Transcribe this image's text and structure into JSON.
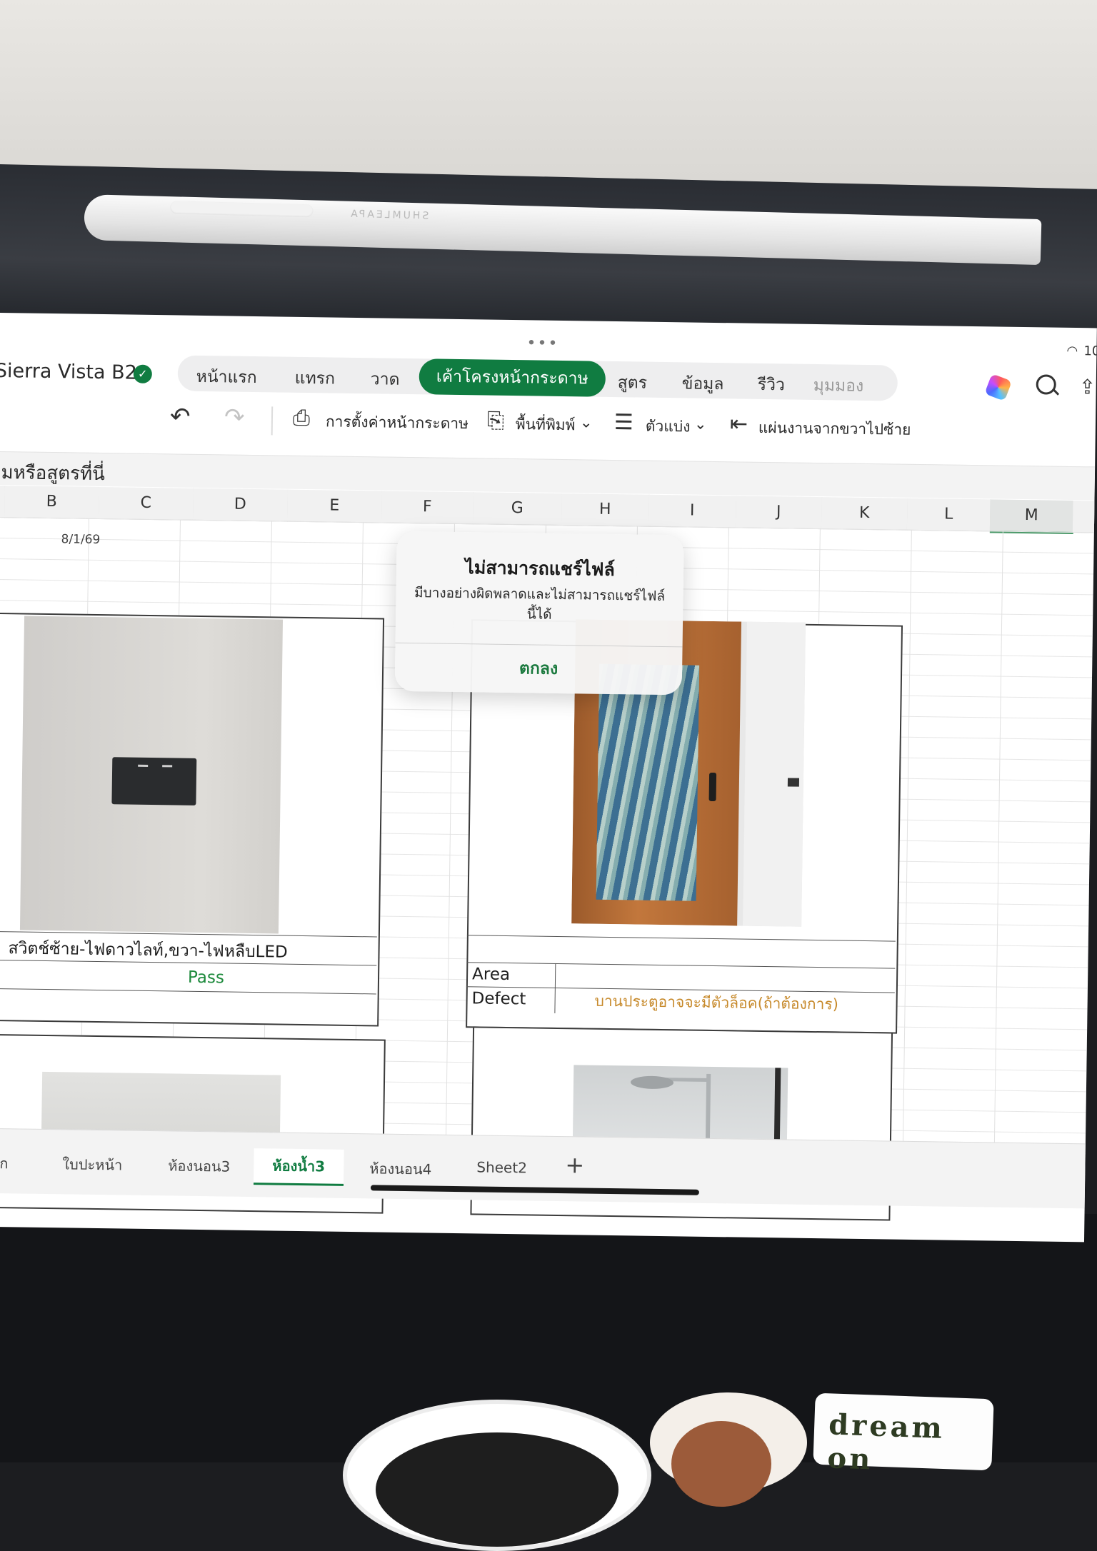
{
  "app": {
    "doc_title": "Sierra Vista B2",
    "ribbon_tabs": [
      {
        "label": "หน้าแรก"
      },
      {
        "label": "แทรก"
      },
      {
        "label": "วาด"
      },
      {
        "label": "เค้าโครงหน้ากระดาษ"
      },
      {
        "label": "สูตร"
      },
      {
        "label": "ข้อมูล"
      },
      {
        "label": "รีวิว"
      },
      {
        "label": "มุมมอง"
      }
    ],
    "active_tab": "เค้าโครงหน้ากระดาษ",
    "accent_color": "#107c41",
    "status": {
      "battery_text": "10"
    }
  },
  "toolbar": {
    "undo_icon": "undo-icon",
    "redo_icon": "redo-icon",
    "page_setup": "การตั้งค่าหน้ากระดาษ",
    "print_area": "พื้นที่พิมพ์",
    "breaks": "ตัวแบ่ง",
    "sheet_rtl": "แผ่นงานจากขวาไปซ้าย"
  },
  "formula_bar": {
    "placeholder": "ามหรือสูตรที่นี่"
  },
  "columns": [
    "B",
    "C",
    "D",
    "E",
    "F",
    "G",
    "H",
    "I",
    "J",
    "K",
    "L",
    "M"
  ],
  "selected_column": "M",
  "cells": {
    "date": "8/1/69",
    "left_caption": "สวิตช์ซ้าย-ไฟดาวไลท์,ขวา-ไฟหลืบLED",
    "left_result": "Pass",
    "area_label": "Area",
    "defect_label": "Defect",
    "defect_value": "บานประตูอาจจะมีตัวล็อค(ถ้าต้องการ)"
  },
  "sheet_tabs": [
    {
      "label": "ปก",
      "display": "าปก"
    },
    {
      "label": "ใบปะหน้า"
    },
    {
      "label": "ห้องนอน3"
    },
    {
      "label": "ห้องน้ำ3"
    },
    {
      "label": "ห้องนอน4"
    },
    {
      "label": "Sheet2"
    }
  ],
  "active_sheet": "ห้องน้ำ3",
  "alert": {
    "title": "ไม่สามารถแชร์ไฟล์",
    "message": "มีบางอย่างผิดพลาดและไม่สามารถแชร์ไฟล์นี้ได้",
    "ok_label": "ตกลง"
  },
  "desk": {
    "sticker_text": "dream on"
  }
}
